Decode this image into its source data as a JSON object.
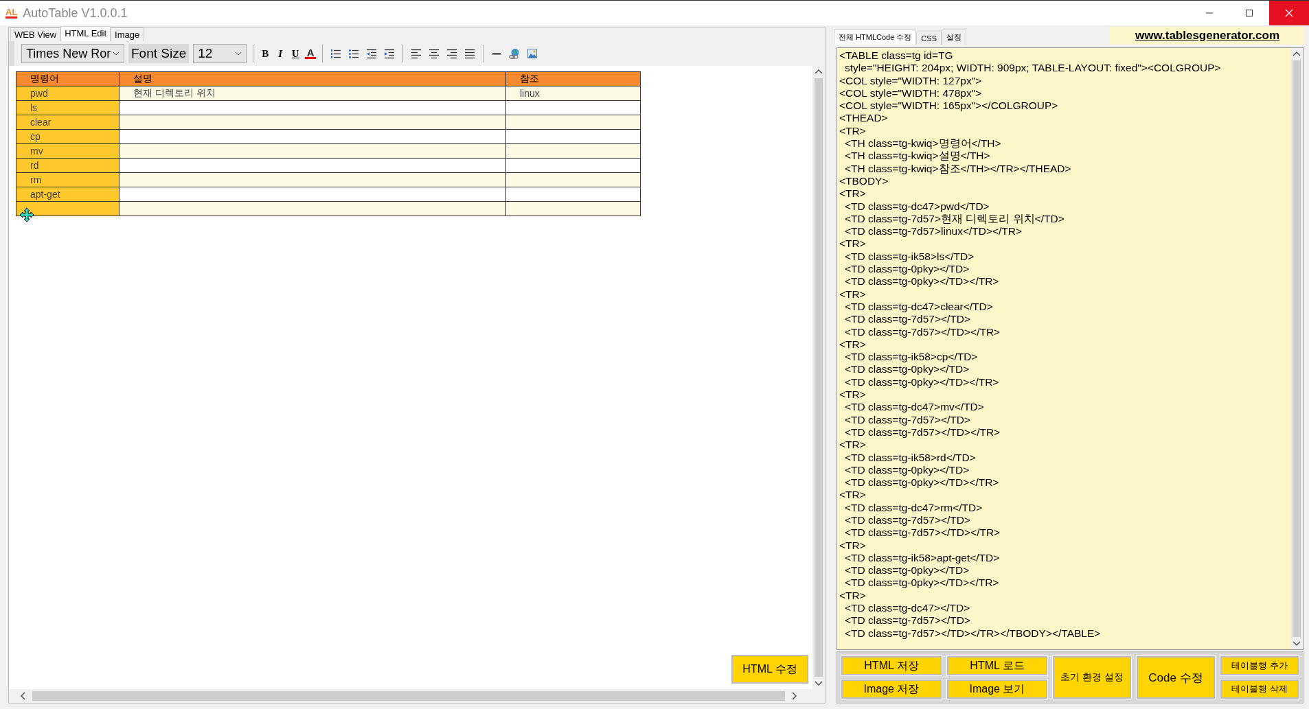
{
  "window": {
    "title": "AutoTable V1.0.0.1",
    "logo": "AL"
  },
  "left_tabs": [
    {
      "label": "WEB View",
      "selected": false
    },
    {
      "label": "HTML Edit",
      "selected": true
    },
    {
      "label": "Image",
      "selected": false
    }
  ],
  "toolbar": {
    "font_name": "Times New Ror",
    "font_size_label": "Font Size",
    "font_size": "12",
    "format_buttons": [
      "B",
      "I",
      "U",
      "A"
    ]
  },
  "table": {
    "columns": [
      "명령어",
      "설명",
      "참조"
    ],
    "rows": [
      {
        "cells": [
          "pwd",
          "현재 디렉토리 위치",
          "linux"
        ],
        "shaded": true
      },
      {
        "cells": [
          "ls"
        ],
        "shaded": false
      },
      {
        "cells": [
          "clear"
        ],
        "shaded": true
      },
      {
        "cells": [
          "cp"
        ],
        "shaded": false
      },
      {
        "cells": [
          "mv"
        ],
        "shaded": true
      },
      {
        "cells": [
          "rd"
        ],
        "shaded": false
      },
      {
        "cells": [
          "rm"
        ],
        "shaded": true
      },
      {
        "cells": [
          "apt-get"
        ],
        "shaded": false
      },
      {
        "shaded": true
      }
    ]
  },
  "html_edit_button": "HTML 수정",
  "right_tabs": [
    {
      "label": "전체 HTMLCode 수정",
      "selected": true
    },
    {
      "label": "CSS",
      "selected": false
    },
    {
      "label": "설정",
      "selected": false
    }
  ],
  "link": "www.tablesgenerator.com",
  "code_lines": [
    {
      "text": "<TABLE class=tg id=TG",
      "indented": false
    },
    {
      "text": "style=\"HEIGHT: 204px; WIDTH: 909px; TABLE-LAYOUT: fixed\"><COLGROUP>",
      "indented": true
    },
    {
      "text": "<COL style=\"WIDTH: 127px\">",
      "indented": false
    },
    {
      "text": "<COL style=\"WIDTH: 478px\">",
      "indented": false
    },
    {
      "text": "<COL style=\"WIDTH: 165px\"></COLGROUP>",
      "indented": false
    },
    {
      "text": "<THEAD>",
      "indented": false
    },
    {
      "text": "<TR>",
      "indented": false
    },
    {
      "text": "<TH class=tg-kwiq>명령어</TH>",
      "indented": true
    },
    {
      "text": "<TH class=tg-kwiq>설명</TH>",
      "indented": true
    },
    {
      "text": "<TH class=tg-kwiq>참조</TH></TR></THEAD>",
      "indented": true
    },
    {
      "text": "<TBODY>",
      "indented": false
    },
    {
      "text": "<TR>",
      "indented": false
    },
    {
      "text": "<TD class=tg-dc47>pwd</TD>",
      "indented": true
    },
    {
      "text": "<TD class=tg-7d57>현재 디렉토리 위치</TD>",
      "indented": true
    },
    {
      "text": "<TD class=tg-7d57>linux</TD></TR>",
      "indented": true
    },
    {
      "text": "<TR>",
      "indented": false
    },
    {
      "text": "<TD class=tg-ik58>ls</TD>",
      "indented": true
    },
    {
      "text": "<TD class=tg-0pky></TD>",
      "indented": true
    },
    {
      "text": "<TD class=tg-0pky></TD></TR>",
      "indented": true
    },
    {
      "text": "<TR>",
      "indented": false
    },
    {
      "text": "<TD class=tg-dc47>clear</TD>",
      "indented": true
    },
    {
      "text": "<TD class=tg-7d57></TD>",
      "indented": true
    },
    {
      "text": "<TD class=tg-7d57></TD></TR>",
      "indented": true
    },
    {
      "text": "<TR>",
      "indented": false
    },
    {
      "text": "<TD class=tg-ik58>cp</TD>",
      "indented": true
    },
    {
      "text": "<TD class=tg-0pky></TD>",
      "indented": true
    },
    {
      "text": "<TD class=tg-0pky></TD></TR>",
      "indented": true
    },
    {
      "text": "<TR>",
      "indented": false
    },
    {
      "text": "<TD class=tg-dc47>mv</TD>",
      "indented": true
    },
    {
      "text": "<TD class=tg-7d57></TD>",
      "indented": true
    },
    {
      "text": "<TD class=tg-7d57></TD></TR>",
      "indented": true
    },
    {
      "text": "<TR>",
      "indented": false
    },
    {
      "text": "<TD class=tg-ik58>rd</TD>",
      "indented": true
    },
    {
      "text": "<TD class=tg-0pky></TD>",
      "indented": true
    },
    {
      "text": "<TD class=tg-0pky></TD></TR>",
      "indented": true
    },
    {
      "text": "<TR>",
      "indented": false
    },
    {
      "text": "<TD class=tg-dc47>rm</TD>",
      "indented": true
    },
    {
      "text": "<TD class=tg-7d57></TD>",
      "indented": true
    },
    {
      "text": "<TD class=tg-7d57></TD></TR>",
      "indented": true
    },
    {
      "text": "<TR>",
      "indented": false
    },
    {
      "text": "<TD class=tg-ik58>apt-get</TD>",
      "indented": true
    },
    {
      "text": "<TD class=tg-0pky></TD>",
      "indented": true
    },
    {
      "text": "<TD class=tg-0pky></TD></TR>",
      "indented": true
    },
    {
      "text": "<TR>",
      "indented": false
    },
    {
      "text": "<TD class=tg-dc47></TD>",
      "indented": true
    },
    {
      "text": "<TD class=tg-7d57></TD>",
      "indented": true
    },
    {
      "text": "<TD class=tg-7d57></TD></TR></TBODY></TABLE>",
      "indented": true
    }
  ],
  "button_columns": [
    [
      "HTML 저장",
      "Image 저장"
    ],
    [
      "HTML 로드",
      "Image 보기"
    ],
    [
      "초기 환경 설정"
    ],
    [
      "Code 수정"
    ],
    [
      "테이블행 추가",
      "테이블행 삭제"
    ]
  ]
}
